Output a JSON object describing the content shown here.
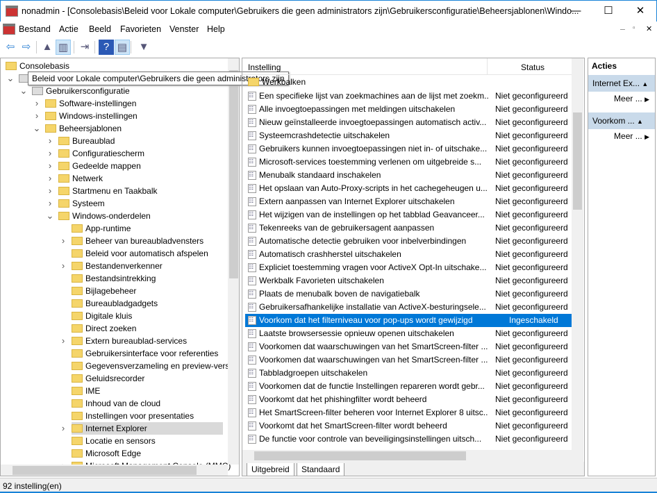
{
  "window": {
    "title": "nonadmin - [Consolebasis\\Beleid voor Lokale computer\\Gebruikers die geen administrators zijn\\Gebruikersconfiguratie\\Beheersjablonen\\Windo...",
    "minimize": "—",
    "maximize": "☐",
    "close": "✕",
    "inner_minimize": "–",
    "inner_restore": "▫",
    "inner_close": "✕"
  },
  "menu": [
    "Bestand",
    "Actie",
    "Beeld",
    "Favorieten",
    "Venster",
    "Help"
  ],
  "toolbar": [
    {
      "icon": "back-icon",
      "glyph": "⇦"
    },
    {
      "icon": "forward-icon",
      "glyph": "⇨"
    },
    {
      "icon": "up-folder-icon",
      "glyph": "▲"
    },
    {
      "icon": "show-hide-tree-icon",
      "glyph": "▥"
    },
    {
      "icon": "export-list-icon",
      "glyph": "⇥"
    },
    {
      "icon": "help-icon",
      "glyph": "?"
    },
    {
      "icon": "show-hide-action-pane-icon",
      "glyph": "▤"
    },
    {
      "icon": "filter-icon",
      "glyph": "▼"
    }
  ],
  "tooltip": "Beleid voor Lokale computer\\Gebruikers die geen administrators zijn",
  "tree": [
    {
      "label": "Consolebasis",
      "level": 0,
      "chev": ""
    },
    {
      "label": "",
      "level": 1,
      "chev": "v"
    },
    {
      "label": "Gebruikersconfiguratie",
      "level": 2,
      "chev": "v"
    },
    {
      "label": "Software-instellingen",
      "level": 3,
      "chev": ">"
    },
    {
      "label": "Windows-instellingen",
      "level": 3,
      "chev": ">"
    },
    {
      "label": "Beheersjablonen",
      "level": 3,
      "chev": "v"
    },
    {
      "label": "Bureaublad",
      "level": 4,
      "chev": ">"
    },
    {
      "label": "Configuratiescherm",
      "level": 4,
      "chev": ">"
    },
    {
      "label": "Gedeelde mappen",
      "level": 4,
      "chev": ">"
    },
    {
      "label": "Netwerk",
      "level": 4,
      "chev": ">"
    },
    {
      "label": "Startmenu en Taakbalk",
      "level": 4,
      "chev": ">"
    },
    {
      "label": "Systeem",
      "level": 4,
      "chev": ">"
    },
    {
      "label": "Windows-onderdelen",
      "level": 4,
      "chev": "v"
    },
    {
      "label": "App-runtime",
      "level": 5,
      "chev": ""
    },
    {
      "label": "Beheer van bureaubladvensters",
      "level": 5,
      "chev": ">"
    },
    {
      "label": "Beleid voor automatisch afspelen",
      "level": 5,
      "chev": ""
    },
    {
      "label": "Bestandenverkenner",
      "level": 5,
      "chev": ">"
    },
    {
      "label": "Bestandsintrekking",
      "level": 5,
      "chev": ""
    },
    {
      "label": "Bijlagebeheer",
      "level": 5,
      "chev": ""
    },
    {
      "label": "Bureaubladgadgets",
      "level": 5,
      "chev": ""
    },
    {
      "label": "Digitale kluis",
      "level": 5,
      "chev": ""
    },
    {
      "label": "Direct zoeken",
      "level": 5,
      "chev": ""
    },
    {
      "label": "Extern bureaublad-services",
      "level": 5,
      "chev": ">"
    },
    {
      "label": "Gebruikersinterface voor referenties",
      "level": 5,
      "chev": ""
    },
    {
      "label": "Gegevensverzameling en preview-versi",
      "level": 5,
      "chev": ""
    },
    {
      "label": "Geluidsrecorder",
      "level": 5,
      "chev": ""
    },
    {
      "label": "IME",
      "level": 5,
      "chev": ""
    },
    {
      "label": "Inhoud van de cloud",
      "level": 5,
      "chev": ""
    },
    {
      "label": "Instellingen voor presentaties",
      "level": 5,
      "chev": ""
    },
    {
      "label": "Internet Explorer",
      "level": 5,
      "chev": ">",
      "selected": true
    },
    {
      "label": "Locatie en sensors",
      "level": 5,
      "chev": ""
    },
    {
      "label": "Microsoft Edge",
      "level": 5,
      "chev": ""
    },
    {
      "label": "Microsoft Management Console (MMC)",
      "level": 5,
      "chev": ">"
    }
  ],
  "list": {
    "col_setting": "Instelling",
    "col_status": "Status",
    "folder_row": "Werkbalken",
    "rows": [
      [
        "Een specifieke lijst van zoekmachines aan de lijst met zoekm...",
        "Niet geconfigureerd"
      ],
      [
        "Alle invoegtoepassingen met meldingen uitschakelen",
        "Niet geconfigureerd"
      ],
      [
        "Nieuw geïnstalleerde invoegtoepassingen automatisch activ...",
        "Niet geconfigureerd"
      ],
      [
        "Systeemcrashdetectie uitschakelen",
        "Niet geconfigureerd"
      ],
      [
        "Gebruikers kunnen invoegtoepassingen niet in- of uitschake...",
        "Niet geconfigureerd"
      ],
      [
        "Microsoft-services toestemming verlenen om uitgebreide s...",
        "Niet geconfigureerd"
      ],
      [
        "Menubalk standaard inschakelen",
        "Niet geconfigureerd"
      ],
      [
        "Het opslaan van Auto-Proxy-scripts in het cachegeheugen u...",
        "Niet geconfigureerd"
      ],
      [
        "Extern aanpassen van Internet Explorer uitschakelen",
        "Niet geconfigureerd"
      ],
      [
        "Het wijzigen van de instellingen op het tabblad Geavanceer...",
        "Niet geconfigureerd"
      ],
      [
        "Tekenreeks van de gebruikersagent aanpassen",
        "Niet geconfigureerd"
      ],
      [
        "Automatische detectie gebruiken voor inbelverbindingen",
        "Niet geconfigureerd"
      ],
      [
        "Automatisch crashherstel uitschakelen",
        "Niet geconfigureerd"
      ],
      [
        "Expliciet toestemming vragen voor ActiveX Opt-In uitschake...",
        "Niet geconfigureerd"
      ],
      [
        "Werkbalk Favorieten uitschakelen",
        "Niet geconfigureerd"
      ],
      [
        "Plaats de menubalk boven de navigatiebalk",
        "Niet geconfigureerd"
      ],
      [
        "Gebruikersafhankelijke installatie van ActiveX-besturingsele...",
        "Niet geconfigureerd"
      ],
      [
        "Voorkom dat het filterniveau voor pop-ups wordt gewijzigd",
        "Ingeschakeld"
      ],
      [
        "Laatste browsersessie opnieuw openen uitschakelen",
        "Niet geconfigureerd"
      ],
      [
        "Voorkomen dat waarschuwingen van het SmartScreen-filter ...",
        "Niet geconfigureerd"
      ],
      [
        "Voorkomen dat waarschuwingen van het SmartScreen-filter ...",
        "Niet geconfigureerd"
      ],
      [
        "Tabbladgroepen uitschakelen",
        "Niet geconfigureerd"
      ],
      [
        "Voorkomen dat de functie Instellingen repareren wordt gebr...",
        "Niet geconfigureerd"
      ],
      [
        "Voorkomt dat het phishingfilter wordt beheerd",
        "Niet geconfigureerd"
      ],
      [
        "Het SmartScreen-filter beheren voor Internet Explorer 8 uitsc...",
        "Niet geconfigureerd"
      ],
      [
        "Voorkomt dat het SmartScreen-filter wordt beheerd",
        "Niet geconfigureerd"
      ],
      [
        "De functie voor controle van beveiligingsinstellingen uitsch...",
        "Niet geconfigureerd"
      ]
    ],
    "selected_index": 17,
    "tabs": [
      "Uitgebreid",
      "Standaard"
    ]
  },
  "actions": {
    "title": "Acties",
    "sections": [
      {
        "header": "Internet Ex...",
        "more": "Meer ..."
      },
      {
        "header": "Voorkom ...",
        "more": "Meer ..."
      }
    ]
  },
  "status": "92 instelling(en)"
}
